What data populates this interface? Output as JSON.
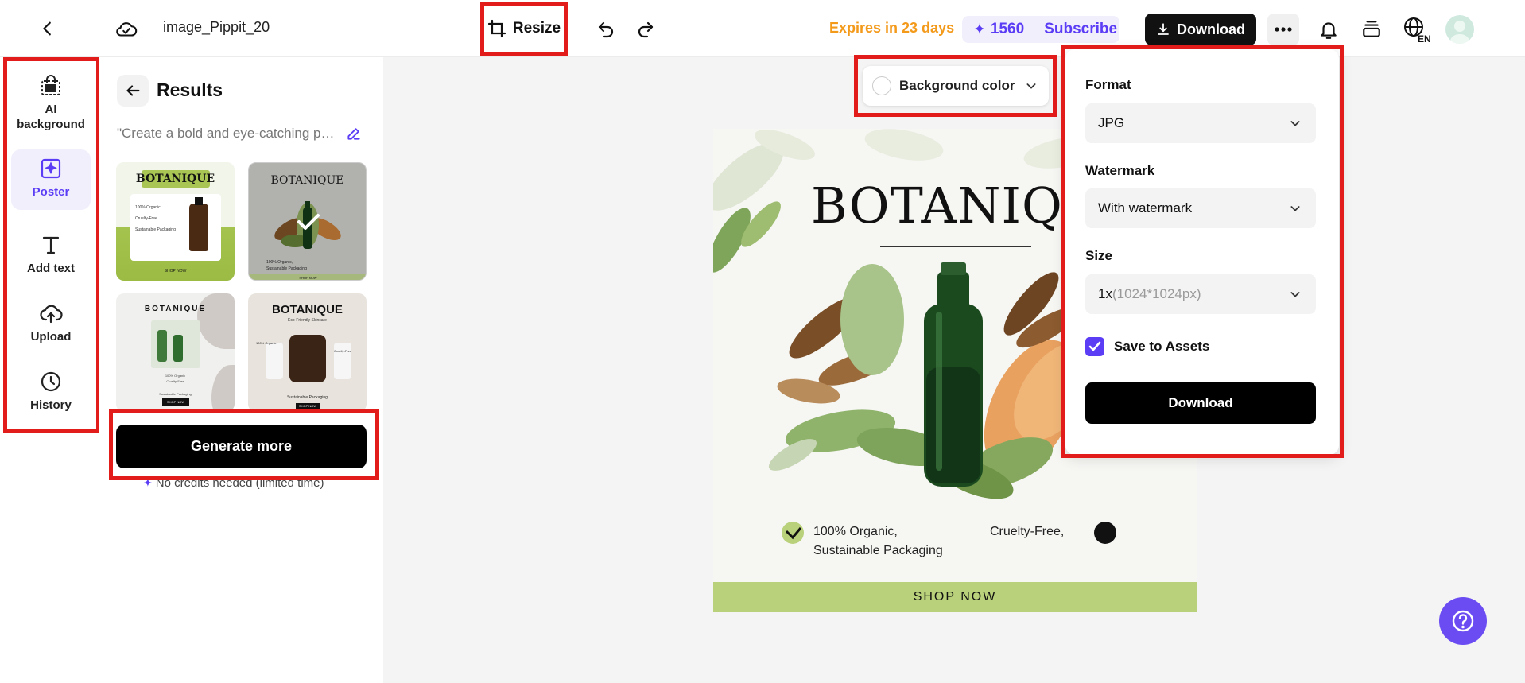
{
  "header": {
    "file_name": "image_Pippit_20",
    "resize_label": "Resize",
    "expires_text": "Expires in 23 days",
    "credits": "1560",
    "subscribe_label": "Subscribe",
    "download_label": "Download",
    "language": "EN"
  },
  "rail": {
    "items": [
      {
        "label": "AI background",
        "icon": "shopping-bag-icon"
      },
      {
        "label": "Poster",
        "icon": "poster-sparkle-icon"
      },
      {
        "label": "Add text",
        "icon": "text-icon"
      },
      {
        "label": "Upload",
        "icon": "cloud-upload-icon"
      },
      {
        "label": "History",
        "icon": "clock-icon"
      }
    ]
  },
  "results": {
    "title": "Results",
    "prompt": "\"Create a bold and eye-catching poster for Botanique",
    "thumbnails": [
      {
        "title": "BOTANIQUE",
        "lines": [
          "100% Organic",
          "Cruelty-Free",
          "Sustainable Packaging"
        ],
        "cta": "SHOP NOW"
      },
      {
        "title": "BOTANIQUE",
        "lines": [
          "100% Organic,",
          "Sustainable Packaging"
        ],
        "cta": "SHOP NOW",
        "selected": true
      },
      {
        "title": "BOTANIQUE",
        "lines": [
          "100% Organic",
          "Cruelty-Free"
        ],
        "cta": "SHOP NOW",
        "footer": "Sustainable Packaging"
      },
      {
        "title": "BOTANIQUE",
        "subtitle": "Eco-Friendly Skincare",
        "lines": [
          "100% Organic",
          "Cruelty-Free"
        ],
        "footer": "Sustainable Packaging",
        "cta": "SHOP NOW"
      }
    ],
    "generate_more_label": "Generate more",
    "no_credits_text": "No credits needed (limited time)"
  },
  "canvas": {
    "bg_color_label": "Background color",
    "poster": {
      "title": "BOTANIQUE",
      "feature_1": "100% Organic,",
      "feature_1b": "Sustainable Packaging",
      "feature_2": "Cruelty-Free,",
      "cta": "SHOP NOW"
    }
  },
  "download_panel": {
    "format_label": "Format",
    "format_value": "JPG",
    "watermark_label": "Watermark",
    "watermark_value": "With watermark",
    "size_label": "Size",
    "size_value": "1x",
    "size_detail": "(1024*1024px)",
    "save_label": "Save to Assets",
    "save_checked": true,
    "download_label": "Download"
  },
  "colors": {
    "accent": "#5b3df5",
    "expires": "#f39a1b",
    "highlight_box": "#e21b1b",
    "shop_bar": "#b8d17a"
  }
}
